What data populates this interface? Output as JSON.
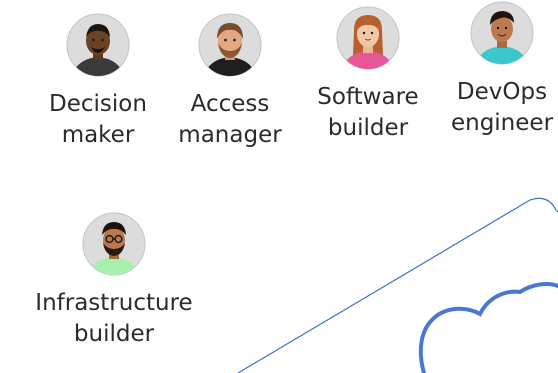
{
  "personas": [
    {
      "id": "decision-maker",
      "label": "Decision\nmaker"
    },
    {
      "id": "access-manager",
      "label": "Access\nmanager"
    },
    {
      "id": "software-builder",
      "label": "Software\nbuilder"
    },
    {
      "id": "devops-engineer",
      "label": "DevOps\nengineer"
    },
    {
      "id": "infrastructure-builder",
      "label": "Infrastructure\nbuilder"
    }
  ],
  "colors": {
    "avatar_bg": "#dcdcdc",
    "avatar_border": "#c4c4c4",
    "cloud_stroke": "#4a78d1",
    "shape_stroke": "#3f6fca",
    "text": "#2b2b2b"
  }
}
